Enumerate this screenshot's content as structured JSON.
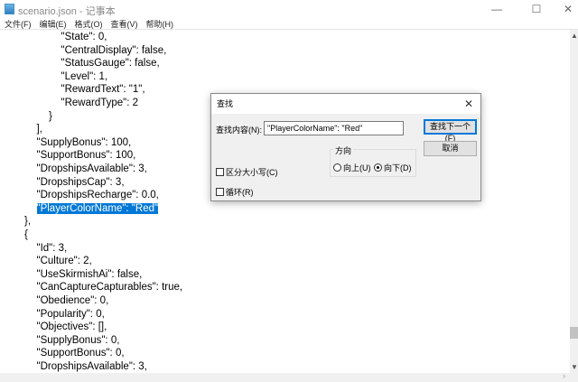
{
  "window": {
    "title": "scenario.json - 记事本",
    "minimize": "—",
    "maximize": "☐",
    "close": "✕"
  },
  "menu": [
    "文件(F)",
    "编辑(E)",
    "格式(O)",
    "查看(V)",
    "帮助(H)"
  ],
  "editor": {
    "lines": [
      {
        "indent": 5,
        "text": "\"State\": 0,"
      },
      {
        "indent": 5,
        "text": "\"CentralDisplay\": false,"
      },
      {
        "indent": 5,
        "text": "\"StatusGauge\": false,"
      },
      {
        "indent": 5,
        "text": "\"Level\": 1,"
      },
      {
        "indent": 5,
        "text": "\"RewardText\": \"1\","
      },
      {
        "indent": 5,
        "text": "\"RewardType\": 2"
      },
      {
        "indent": 4,
        "text": "}"
      },
      {
        "indent": 3,
        "text": "],"
      },
      {
        "indent": 3,
        "text": "\"SupplyBonus\": 100,"
      },
      {
        "indent": 3,
        "text": "\"SupportBonus\": 100,"
      },
      {
        "indent": 3,
        "text": "\"DropshipsAvailable\": 3,"
      },
      {
        "indent": 3,
        "text": "\"DropshipsCap\": 3,"
      },
      {
        "indent": 3,
        "text": "\"DropshipsRecharge\": 0.0,"
      },
      {
        "indent": 3,
        "text": "\"PlayerColorName\": \"Red\"",
        "selected": true
      },
      {
        "indent": 2,
        "text": "},"
      },
      {
        "indent": 2,
        "text": "{"
      },
      {
        "indent": 3,
        "text": "\"Id\": 3,"
      },
      {
        "indent": 3,
        "text": "\"Culture\": 2,"
      },
      {
        "indent": 3,
        "text": "\"UseSkirmishAi\": false,"
      },
      {
        "indent": 3,
        "text": "\"CanCaptureCapturables\": true,"
      },
      {
        "indent": 3,
        "text": "\"Obedience\": 0,"
      },
      {
        "indent": 3,
        "text": "\"Popularity\": 0,"
      },
      {
        "indent": 3,
        "text": "\"Objectives\": [],"
      },
      {
        "indent": 3,
        "text": "\"SupplyBonus\": 0,"
      },
      {
        "indent": 3,
        "text": "\"SupportBonus\": 0,"
      },
      {
        "indent": 3,
        "text": "\"DropshipsAvailable\": 3,"
      }
    ]
  },
  "find_dialog": {
    "title": "查找",
    "close": "✕",
    "find_label": "查找内容(N):",
    "find_value": "\"PlayerColorName\": \"Red\"",
    "find_next": "查找下一个(F)",
    "cancel": "取消",
    "direction_label": "方向",
    "up": "向上(U)",
    "down": "向下(D)",
    "direction": "down",
    "match_case": "区分大小写(C)",
    "match_case_checked": false,
    "wrap": "循环(R)",
    "wrap_checked": false
  }
}
